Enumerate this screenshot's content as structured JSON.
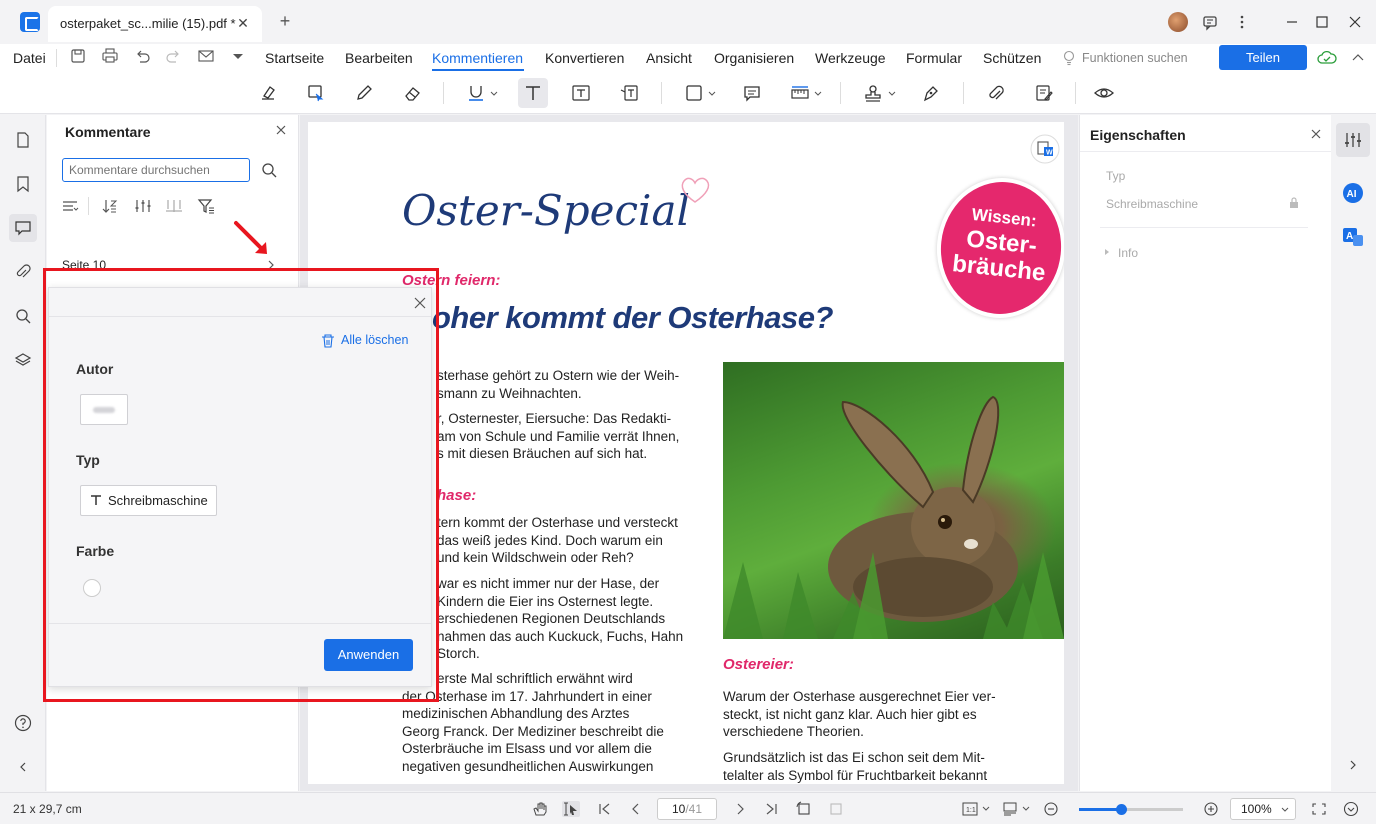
{
  "titlebar": {
    "tab_label": "osterpaket_sc...milie (15).pdf *",
    "close": "✕",
    "new_tab": "+"
  },
  "menu": {
    "file": "Datei",
    "items": [
      "Startseite",
      "Bearbeiten",
      "Kommentieren",
      "Konvertieren",
      "Ansicht",
      "Organisieren",
      "Werkzeuge",
      "Formular",
      "Schützen"
    ],
    "active": "Kommentieren",
    "feature_search": "Funktionen suchen",
    "share": "Teilen"
  },
  "comments_panel": {
    "title": "Kommentare",
    "search_placeholder": "Kommentare durchsuchen",
    "page_label": "Seite 10"
  },
  "filter_popup": {
    "clear_all": "Alle löschen",
    "author_label": "Autor",
    "type_label": "Typ",
    "type_chip": "Schreibmaschine",
    "color_label": "Farbe",
    "apply": "Anwenden"
  },
  "document": {
    "title": "Oster-Special",
    "section_celebrate": "Ostern feiern:",
    "headline": "oher kommt der Osterhase?",
    "intro_1": "sterhase gehört zu Ostern wie der Weih-",
    "intro_2": "smann zu Weihnachten.",
    "intro_3": "r, Osternester, Eiersuche: Das Redakti-",
    "intro_4": "am von Schule und Familie verrät Ihnen,",
    "intro_5": "s mit diesen Bräuchen auf sich hat.",
    "section_hare": "hase:",
    "p1_1": "tern kommt der Osterhase und versteckt",
    "p1_2": "das weiß jedes Kind. Doch warum ein",
    "p1_3": "und kein Wildschwein oder Reh?",
    "p2_1": "war es nicht immer nur der Hase, der",
    "p2_2": "Kindern die Eier ins Osternest legte.",
    "p2_3": "erschiedenen Regionen Deutschlands",
    "p2_4": "nahmen das auch Kuckuck, Fuchs, Hahn",
    "p2_5": "Storch.",
    "p3_1": "erste Mal schriftlich erwähnt wird",
    "p3_2": "der Osterhase im 17. Jahrhundert in einer",
    "p3_3": "medizinischen Abhandlung des Arztes",
    "p3_4": "Georg Franck. Der Mediziner beschreibt die",
    "p3_5": "Osterbräuche im Elsass und vor allem die",
    "p3_6": "negativen gesundheitlichen Auswirkungen",
    "badge_top": "Wissen:",
    "badge_main_1": "Oster-",
    "badge_main_2": "bräuche",
    "section_eggs": "Ostereier:",
    "e1_1": "Warum der Osterhase ausgerechnet Eier ver-",
    "e1_2": "steckt, ist nicht ganz klar. Auch hier gibt es",
    "e1_3": "verschiedene Theorien.",
    "e2_1": "Grundsätzlich ist das Ei schon seit dem Mit-",
    "e2_2": "telalter als Symbol für Fruchtbarkeit bekannt"
  },
  "properties": {
    "title": "Eigenschaften",
    "type_label": "Typ",
    "type_value": "Schreibmaschine",
    "info": "Info"
  },
  "statusbar": {
    "page_size": "21 x 29,7 cm",
    "page_current": "10",
    "page_total": "/41",
    "zoom": "100%",
    "zoom_fraction": 0.4
  },
  "colors": {
    "accent": "#1a6fe6",
    "highlight_red": "#e8161f",
    "pink": "#e5286d",
    "navy": "#1e3a78"
  }
}
